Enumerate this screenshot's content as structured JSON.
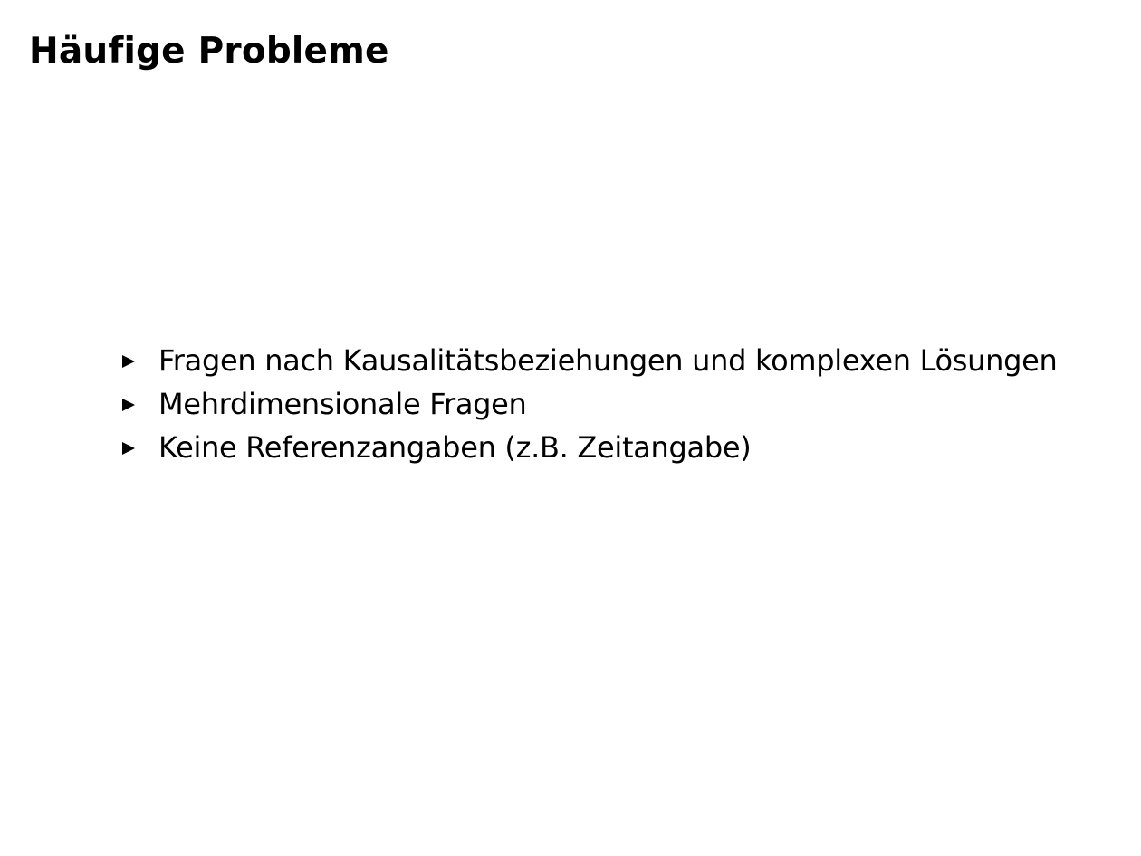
{
  "slide": {
    "title": "Häufige Probleme",
    "bullets": [
      "Fragen nach Kausalitätsbeziehungen und komplexen Lösungen",
      "Mehrdimensionale Fragen",
      "Keine Referenzangaben (z.B. Zeitangabe)"
    ]
  },
  "icons": {
    "bullet_marker": "triangle-right-icon"
  },
  "colors": {
    "background": "#ffffff",
    "text": "#000000"
  }
}
